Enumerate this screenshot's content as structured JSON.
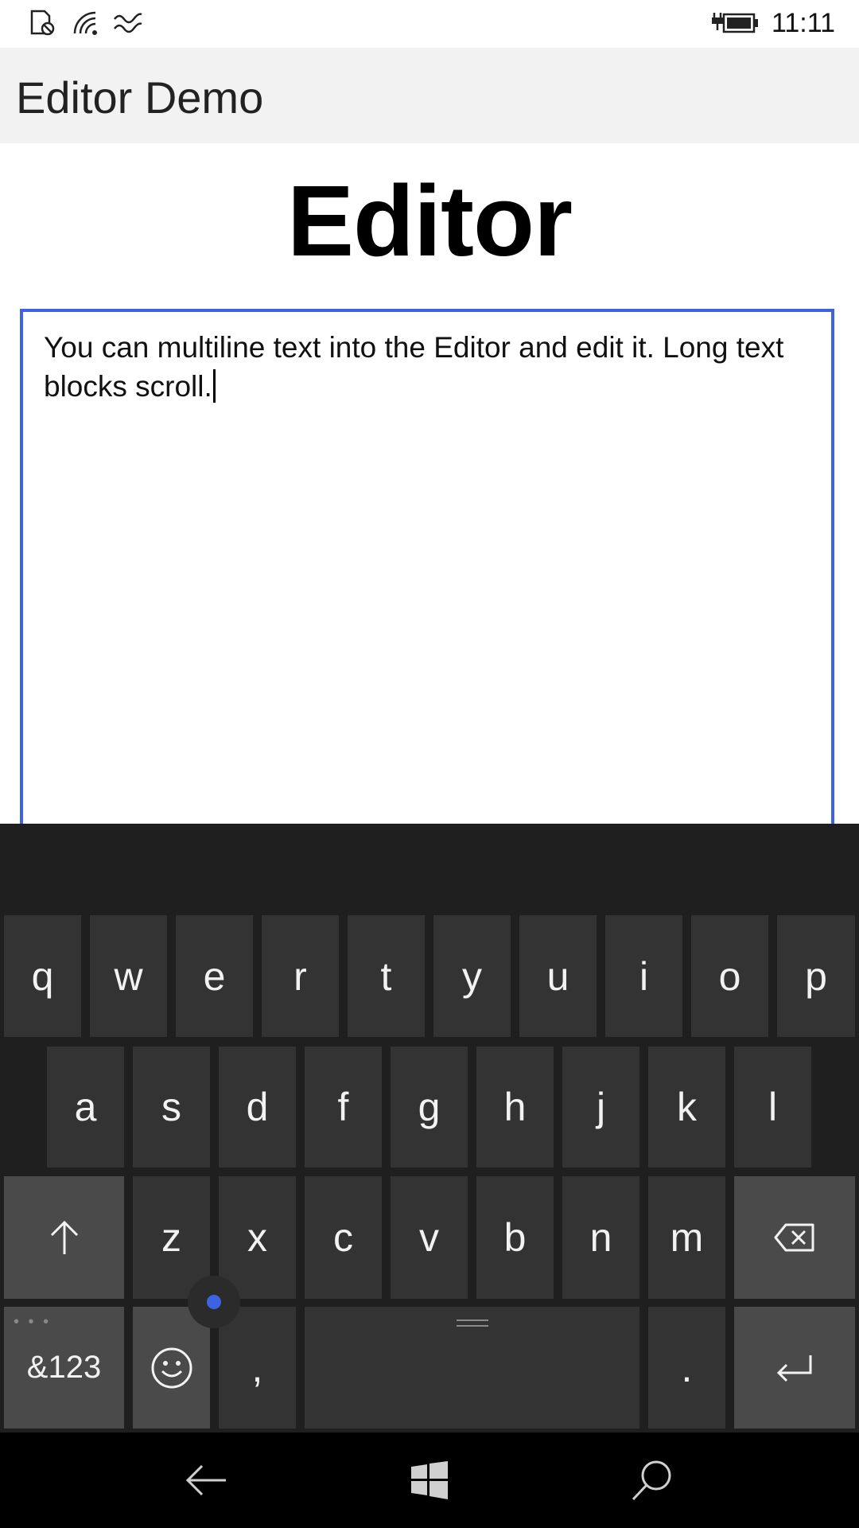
{
  "status_bar": {
    "time": "11:11",
    "icons": [
      "sim-icon",
      "wifi-icon",
      "data-sense-icon",
      "battery-charging-icon"
    ]
  },
  "app": {
    "title": "Editor Demo"
  },
  "page": {
    "heading": "Editor"
  },
  "editor": {
    "text": "You can multiline text into the Editor and edit it. Long text blocks scroll."
  },
  "keyboard": {
    "row1": [
      "q",
      "w",
      "e",
      "r",
      "t",
      "y",
      "u",
      "i",
      "o",
      "p"
    ],
    "row2": [
      "a",
      "s",
      "d",
      "f",
      "g",
      "h",
      "j",
      "k",
      "l"
    ],
    "row3": [
      "z",
      "x",
      "c",
      "v",
      "b",
      "n",
      "m"
    ],
    "symbols_label": "&123",
    "comma_label": ",",
    "period_label": "."
  },
  "colors": {
    "accent": "#3d63e3",
    "keyboard_bg": "#1f1f1f",
    "key_bg": "#333333",
    "func_key_bg": "#4a4a4a"
  }
}
